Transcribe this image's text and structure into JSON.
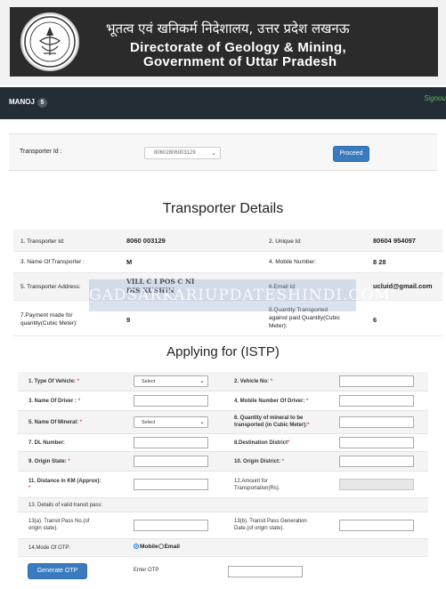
{
  "header": {
    "title_hindi": "भूतत्व एवं खनिकर्म निदेशालय, उत्तर प्रदेश लखनऊ",
    "title_en_1": "Directorate of Geology & Mining,",
    "title_en_2": "Government of Uttar Pradesh"
  },
  "navbar": {
    "user": "MANOJ",
    "badge": "5",
    "signout": "Signou"
  },
  "transporter_select": {
    "label": "Transporter Id :",
    "selected": "80602806003129",
    "proceed": "Proceed"
  },
  "details": {
    "heading": "Transporter Details",
    "rows": [
      {
        "l1": "1. Transporter Id:",
        "v1": "8060   003129",
        "l2": "2. Unique Id:",
        "v2": "80604    954097"
      },
      {
        "l1": "3. Name Of Transporter :",
        "v1": "M",
        "l2": "4. Mobile Number:",
        "v2": "8          28"
      },
      {
        "l1": "5. Transporter Address:",
        "v1": "VILL C       I POS C         NI",
        "v1b": "DIS KUSHIN",
        "l2": "6.Email Id:",
        "v2": "ucluid@gmail.com"
      },
      {
        "l1": "7.Payment made for",
        "l1b": "quantity(Cubic Meter):",
        "v1": "9",
        "l2": "8.Quantity Transported",
        "l2b": "against paid Quantity(Cubic",
        "l2c": "Meter):",
        "v2": "6"
      }
    ],
    "watermark": "GADSARKARIUPDATESHINDI.COM"
  },
  "form": {
    "heading": "Applying for (ISTP)",
    "f1": "1. Type Of Vehicle:",
    "f1_sel": "Select",
    "f2": "2. Vehicle No:",
    "f3": "3. Name Of Driver :",
    "f4": "4. Mobile Number Of Driver:",
    "f5": "5. Name Of Mineral:",
    "f5_sel": "Select",
    "f6a": "6. Quantity of mineral to be",
    "f6b": "transported (in Cubic Meter):",
    "f7": "7. DL Number:",
    "f8": "8.Destination District",
    "f9": "9. Origin State:",
    "f10": "10. Origin District:",
    "f11a": "11. Distance in KM (Approx):",
    "f12a": "12.Amount for",
    "f12b": "Transportation(Rs).",
    "f13": "13. Details of valid transit pass:",
    "f13a_1": "13(a). Transit Pass No.(of",
    "f13a_2": "origin state).",
    "f13b_1": "13(b). Transit Pass Generation",
    "f13b_2": "Date.(of origin state).",
    "f14": "14.Mode Of OTP:",
    "otp_mobile": "Mobile",
    "otp_email": "Email",
    "generate_otp": "Generate OTP",
    "enter_otp": "Enter OTP"
  },
  "colors": {
    "nav": "#232d36",
    "banner": "#2b2b2b",
    "button": "#3a7bbf",
    "required": "#d9534f"
  }
}
